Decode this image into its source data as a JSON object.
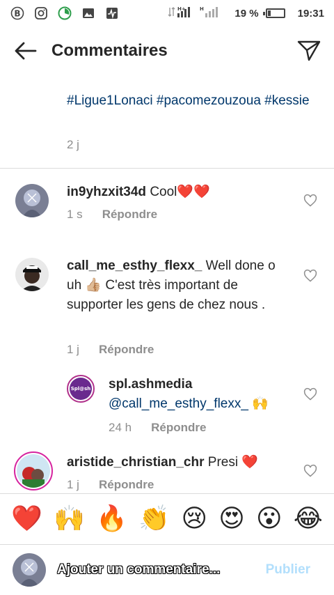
{
  "status_bar": {
    "net_label_1": "H+",
    "net_label_2": "H",
    "battery": "19 %",
    "battery_level": 0.19,
    "time": "19:31"
  },
  "header": {
    "title": "Commentaires"
  },
  "caption": {
    "text": "#Ligue1Lonaci #pacomezouzoua #kessie",
    "time": "2 j"
  },
  "comments": [
    {
      "username": "in9yhzxit34d",
      "text": "Cool❤️❤️",
      "time": "1 s",
      "reply": "Répondre"
    },
    {
      "username": "call_me_esthy_flexx_",
      "text": "Well done o uh 👍🏼 C'est très important de supporter  les gens de chez  nous .",
      "time": "1 j",
      "reply": "Répondre"
    },
    {
      "username": "spl.ashmedia",
      "avatar_text": "Spl@sh",
      "mention": "@call_me_esthy_flexx_",
      "text": "🙌",
      "time": "24 h",
      "reply": "Répondre"
    },
    {
      "username": "aristide_christian_chr",
      "text": "Presi ❤️",
      "time": "1 j",
      "reply": "Répondre"
    }
  ],
  "reactions": [
    "❤️",
    "🙌",
    "🔥",
    "👏",
    "😢",
    "😍",
    "😮",
    "😂"
  ],
  "input": {
    "placeholder": "Ajouter un commentaire...",
    "publish": "Publier"
  },
  "colors": {
    "link": "#00376b",
    "muted": "#8e8e8e",
    "publish_disabled": "#b2dffc"
  }
}
